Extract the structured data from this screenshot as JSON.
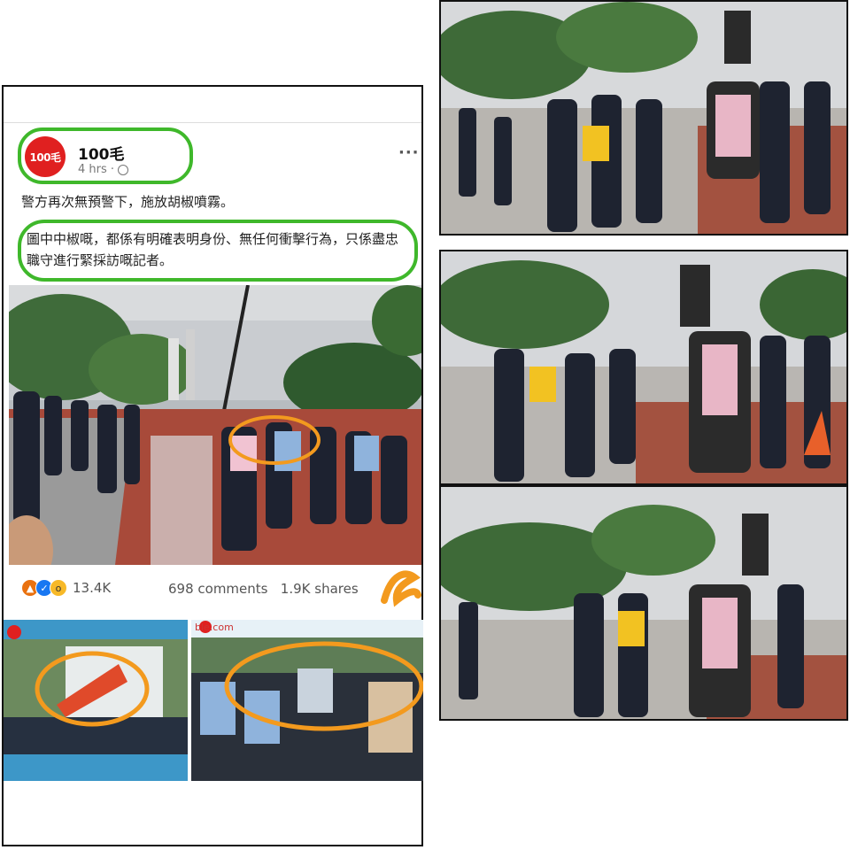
{
  "post": {
    "page_name": "100毛",
    "avatar_text": "100毛",
    "time": "4 hrs ·",
    "more": "···",
    "caption_line": "警方再次無預警下，施放胡椒噴霧。",
    "caption_body": "圖中中椒嘅，都係有明確表明身份、無任何衝擊行為，只係盡忠職守進行緊採訪嘅記者。",
    "reaction_count": "13.4K",
    "comments": "698 comments",
    "shares": "1.9K shares"
  },
  "embed": {
    "watermark": "ble.com"
  },
  "colors": {
    "highlight_green": "#3fb82b",
    "highlight_orange": "#f39a1e",
    "avatar_red": "#e02020"
  },
  "icons": [
    "angry-reaction-icon",
    "like-reaction-icon",
    "wow-reaction-icon",
    "globe-icon",
    "more-options-icon"
  ]
}
